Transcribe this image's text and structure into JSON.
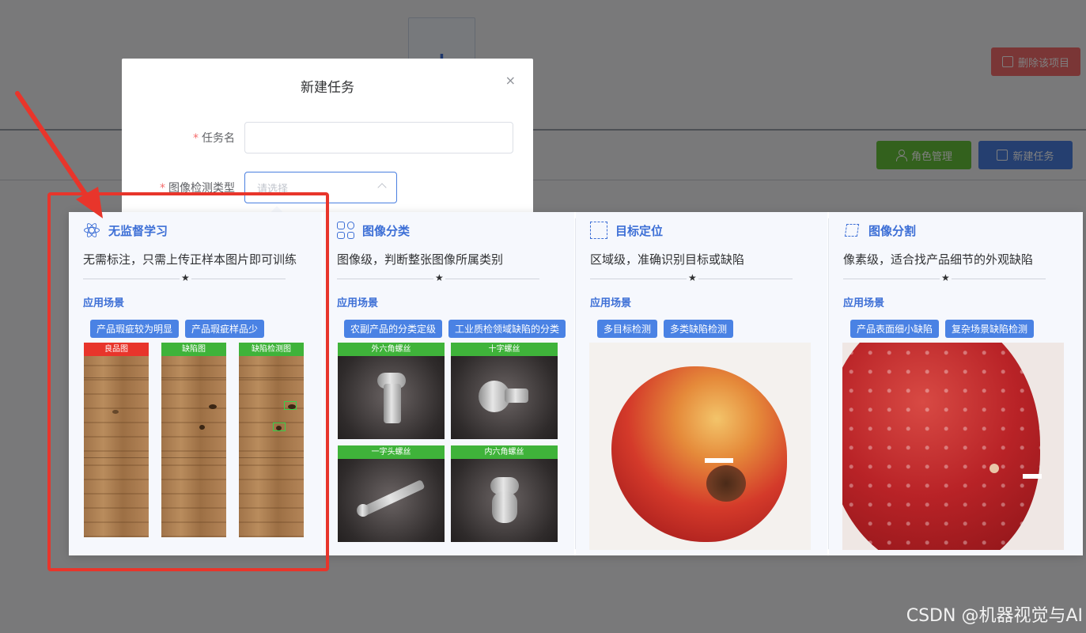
{
  "background": {
    "plus_symbol": "+",
    "delete_project_label": "删除该项目",
    "role_management_label": "角色管理",
    "new_task_label": "新建任务"
  },
  "dialog": {
    "title": "新建任务",
    "close_symbol": "×",
    "task_name_label": "任务名",
    "task_name_value": "",
    "detect_type_label": "图像检测类型",
    "detect_type_placeholder": "请选择",
    "required_mark": "*"
  },
  "options": [
    {
      "title": "无监督学习",
      "icon": "atom-icon",
      "desc": "无需标注，只需上传正样本图片即可训练",
      "scene_label": "应用场景",
      "tags": [
        "产品瑕疵较为明显",
        "产品瑕疵样品少"
      ],
      "images": [
        "良品图",
        "缺陷图",
        "缺陷检测图"
      ]
    },
    {
      "title": "图像分类",
      "icon": "grid-icon",
      "desc": "图像级，判断整张图像所属类别",
      "scene_label": "应用场景",
      "tags": [
        "农副产品的分类定级",
        "工业质检领域缺陷的分类"
      ],
      "images": [
        "外六角螺丝",
        "十字螺丝",
        "一字头螺丝",
        "内六角螺丝"
      ]
    },
    {
      "title": "目标定位",
      "icon": "crop-icon",
      "desc": "区域级，准确识别目标或缺陷",
      "scene_label": "应用场景",
      "tags": [
        "多目标检测",
        "多类缺陷检测"
      ]
    },
    {
      "title": "图像分割",
      "icon": "segment-icon",
      "desc": "像素级，适合找产品细节的外观缺陷",
      "scene_label": "应用场景",
      "tags": [
        "产品表面细小缺陷",
        "复杂场景缺陷检测"
      ]
    }
  ],
  "star_symbol": "★",
  "watermark": "CSDN @机器视觉与AI",
  "colors": {
    "accent": "#3d6fd6",
    "tag_bg": "#4a82e4",
    "annotation": "#e8352b",
    "good_label": "#e8352b",
    "defect_label": "#3fb33a"
  }
}
